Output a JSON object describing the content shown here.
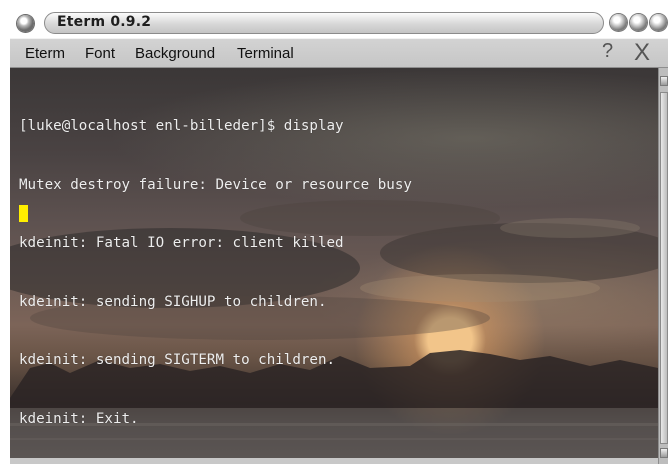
{
  "window": {
    "title": "Eterm 0.9.2"
  },
  "menubar": {
    "items": [
      {
        "label": "Eterm"
      },
      {
        "label": "Font"
      },
      {
        "label": "Background"
      },
      {
        "label": "Terminal"
      }
    ],
    "help_label": "?",
    "close_label": "X"
  },
  "terminal": {
    "lines": [
      "[luke@localhost enl-billeder]$ display",
      "Mutex destroy failure: Device or resource busy",
      "kdeinit: Fatal IO error: client killed",
      "kdeinit: sending SIGHUP to children.",
      "kdeinit: sending SIGTERM to children.",
      "kdeinit: Exit."
    ],
    "cursor_color": "#ffef00",
    "text_color": "#eeeeee"
  },
  "colors": {
    "menubar_bg": "#cccccc",
    "title_pill": "#d7d7d7"
  }
}
